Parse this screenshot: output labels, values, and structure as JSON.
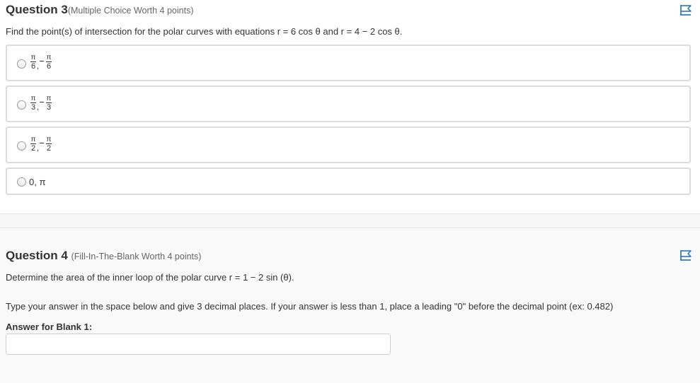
{
  "q3": {
    "title": "Question 3",
    "meta": "(Multiple Choice Worth 4 points)",
    "prompt": "Find the point(s) of intersection for the polar curves with equations r = 6 cos θ and r = 4 − 2 cos θ.",
    "options": [
      {
        "num1": "π",
        "den1": "6",
        "num2": "π",
        "den2": "6"
      },
      {
        "num1": "π",
        "den1": "3",
        "num2": "π",
        "den2": "3"
      },
      {
        "num1": "π",
        "den1": "2",
        "num2": "π",
        "den2": "2"
      },
      {
        "text": "0, π"
      }
    ]
  },
  "q4": {
    "title": "Question 4",
    "meta": "(Fill-In-The-Blank Worth 4 points)",
    "prompt": "Determine the area of the inner loop of the polar curve r = 1 − 2 sin (θ).",
    "instructions": "Type your answer in the space below and give 3 decimal places. If your answer is less than 1, place a leading \"0\" before the decimal point (ex: 0.482)",
    "blank_label": "Answer for Blank 1:",
    "blank_value": ""
  },
  "colors": {
    "flag": "#1a6fc4",
    "border": "#dcdcdc"
  },
  "icons": [
    "flag-icon"
  ]
}
